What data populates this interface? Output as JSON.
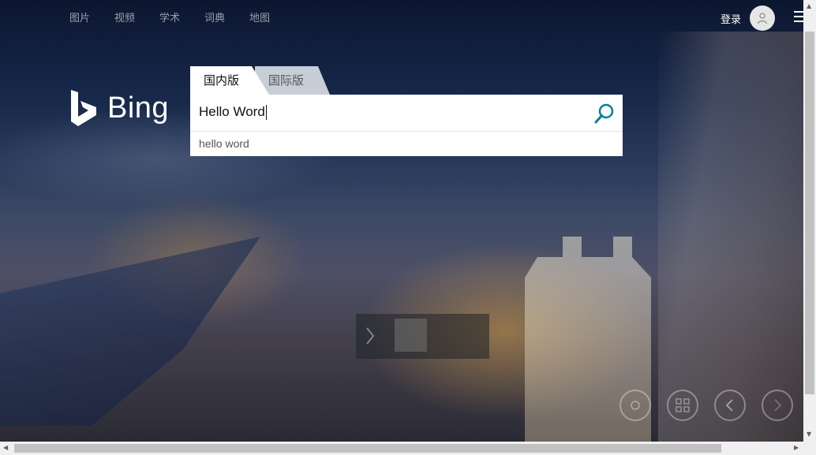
{
  "nav": {
    "items": [
      "图片",
      "视频",
      "学术",
      "词典",
      "地图"
    ],
    "login_label": "登录"
  },
  "logo": {
    "text": "Bing"
  },
  "tabs": [
    {
      "label": "国内版",
      "active": true
    },
    {
      "label": "国际版",
      "active": false
    }
  ],
  "search": {
    "value": "Hello Word"
  },
  "suggestions": [
    "hello word"
  ],
  "colors": {
    "accent": "#00809d",
    "panel": "#ffffff",
    "inactive_tab": "#c8ced8"
  },
  "icons": {
    "search": "search-icon",
    "avatar": "user-icon",
    "menu": "hamburger-icon"
  }
}
